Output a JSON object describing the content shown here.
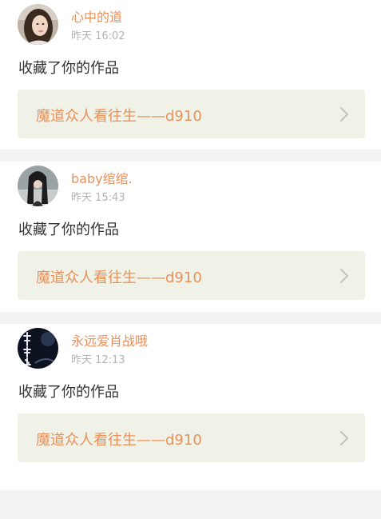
{
  "notifications": [
    {
      "username": "心中的道",
      "time": "昨天 16:02",
      "action": "收藏了你的作品",
      "work_title": "魔道众人看往生——d910",
      "avatar_icon": "avatar-girl-photo"
    },
    {
      "username": "baby绾绾.",
      "time": "昨天 15:43",
      "action": "收藏了你的作品",
      "work_title": "魔道众人看往生——d910",
      "avatar_icon": "avatar-longhair-photo"
    },
    {
      "username": "永远爱肖战哦",
      "time": "昨天 12:13",
      "action": "收藏了你的作品",
      "work_title": "魔道众人看往生——d910",
      "avatar_icon": "avatar-calligraphy"
    }
  ],
  "colors": {
    "accent": "#e8915a",
    "link_bg": "#f1f2e7",
    "page_bg": "#f3f3f3",
    "time_text": "#b3b3b3"
  }
}
